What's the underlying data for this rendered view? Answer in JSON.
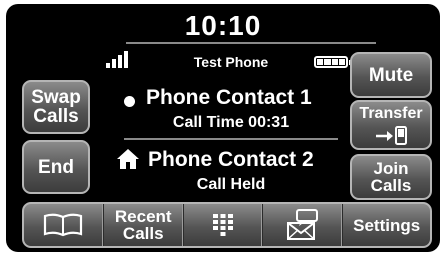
{
  "status": {
    "time": "10:10",
    "device_name": "Test Phone",
    "signal_bars": 4,
    "battery_level": "full"
  },
  "active_call": {
    "name": "Phone Contact 1",
    "time_label": "Call Time 00:31"
  },
  "held_call": {
    "name": "Phone Contact 2",
    "status": "Call Held"
  },
  "left_buttons": {
    "swap_line1": "Swap",
    "swap_line2": "Calls",
    "end": "End"
  },
  "right_buttons": {
    "mute": "Mute",
    "transfer": "Transfer",
    "join_line1": "Join",
    "join_line2": "Calls"
  },
  "bottom_bar": {
    "recent_line1": "Recent",
    "recent_line2": "Calls",
    "settings": "Settings",
    "icons": [
      "phonebook-icon",
      "keypad-icon",
      "messages-icon"
    ]
  }
}
